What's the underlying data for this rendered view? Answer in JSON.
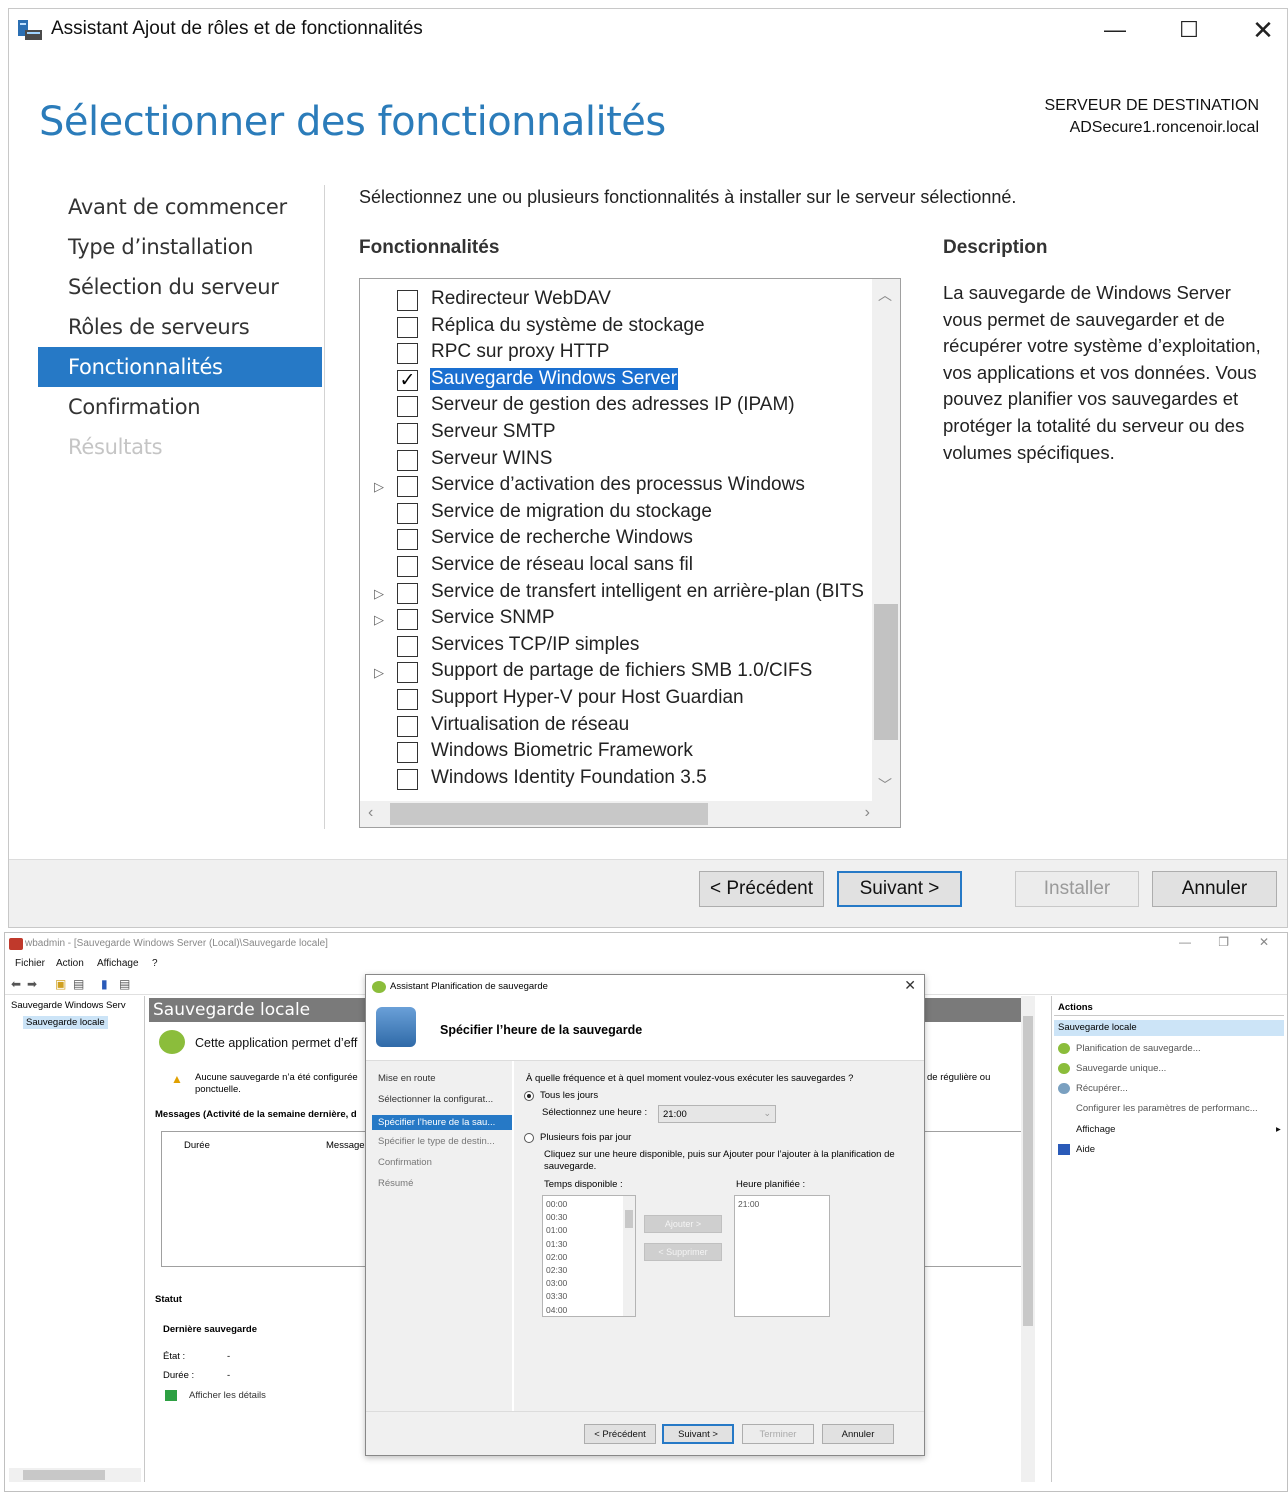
{
  "wizard": {
    "window_title": "Assistant Ajout de rôles et de fonctionnalités",
    "window_controls": {
      "minimize": "—",
      "maximize": "☐",
      "close": "✕"
    },
    "page_title": "Sélectionner des fonctionnalités",
    "destination_label": "SERVEUR DE DESTINATION",
    "destination_server": "ADSecure1.roncenoir.local",
    "nav": [
      {
        "label": "Avant de commencer",
        "state": "normal"
      },
      {
        "label": "Type d’installation",
        "state": "normal"
      },
      {
        "label": "Sélection du serveur",
        "state": "normal"
      },
      {
        "label": "Rôles de serveurs",
        "state": "normal"
      },
      {
        "label": "Fonctionnalités",
        "state": "active"
      },
      {
        "label": "Confirmation",
        "state": "normal"
      },
      {
        "label": "Résultats",
        "state": "disabled"
      }
    ],
    "intro": "Sélectionnez une ou plusieurs fonctionnalités à installer sur le serveur sélectionné.",
    "features_heading": "Fonctionnalités",
    "description_heading": "Description",
    "description_text": "La sauvegarde de Windows Server vous permet de sauvegarder et de récupérer votre système d’exploitation, vos applications et vos données. Vous pouvez planifier vos sauvegardes et protéger la totalité du serveur ou des volumes spécifiques.",
    "features": [
      {
        "label": "Redirecteur WebDAV",
        "checked": false,
        "expandable": false,
        "selected": false
      },
      {
        "label": "Réplica du système de stockage",
        "checked": false,
        "expandable": false,
        "selected": false
      },
      {
        "label": "RPC sur proxy HTTP",
        "checked": false,
        "expandable": false,
        "selected": false
      },
      {
        "label": "Sauvegarde Windows Server",
        "checked": true,
        "expandable": false,
        "selected": true
      },
      {
        "label": "Serveur de gestion des adresses IP (IPAM)",
        "checked": false,
        "expandable": false,
        "selected": false
      },
      {
        "label": "Serveur SMTP",
        "checked": false,
        "expandable": false,
        "selected": false
      },
      {
        "label": "Serveur WINS",
        "checked": false,
        "expandable": false,
        "selected": false
      },
      {
        "label": "Service d’activation des processus Windows",
        "checked": false,
        "expandable": true,
        "selected": false
      },
      {
        "label": "Service de migration du stockage",
        "checked": false,
        "expandable": false,
        "selected": false
      },
      {
        "label": "Service de recherche Windows",
        "checked": false,
        "expandable": false,
        "selected": false
      },
      {
        "label": "Service de réseau local sans fil",
        "checked": false,
        "expandable": false,
        "selected": false
      },
      {
        "label": "Service de transfert intelligent en arrière-plan (BITS",
        "checked": false,
        "expandable": true,
        "selected": false
      },
      {
        "label": "Service SNMP",
        "checked": false,
        "expandable": true,
        "selected": false
      },
      {
        "label": "Services TCP/IP simples",
        "checked": false,
        "expandable": false,
        "selected": false
      },
      {
        "label": "Support de partage de fichiers SMB 1.0/CIFS",
        "checked": false,
        "expandable": true,
        "selected": false
      },
      {
        "label": "Support Hyper-V pour Host Guardian",
        "checked": false,
        "expandable": false,
        "selected": false
      },
      {
        "label": "Virtualisation de réseau",
        "checked": false,
        "expandable": false,
        "selected": false
      },
      {
        "label": "Windows Biometric Framework",
        "checked": false,
        "expandable": false,
        "selected": false
      },
      {
        "label": "Windows Identity Foundation 3.5",
        "checked": false,
        "expandable": false,
        "selected": false
      }
    ],
    "buttons": {
      "previous": "< Précédent",
      "next": "Suivant >",
      "install": "Installer",
      "cancel": "Annuler"
    },
    "accent_color": "#2679c6"
  },
  "wbadmin": {
    "title": "wbadmin - [Sauvegarde Windows Server (Local)\\Sauvegarde locale]",
    "menu": [
      "Fichier",
      "Action",
      "Affichage",
      "?"
    ],
    "tree": {
      "root": "Sauvegarde Windows Serv",
      "child": "Sauvegarde locale"
    },
    "center": {
      "header": "Sauvegarde locale",
      "app_desc": "Cette application permet d’eff",
      "warning": "Aucune sauvegarde n’a été configurée ponctuelle.",
      "right_fragment": "de régulière ou",
      "messages_heading": "Messages (Activité de la semaine dernière, d",
      "col_duration": "Durée",
      "col_message": "Message",
      "status_heading": "Statut",
      "last_backup": "Dernière sauvegarde",
      "state_label": "État :",
      "state_value": "-",
      "duration_label": "Durée :",
      "duration_value": "-",
      "details_link": "Afficher les détails"
    },
    "actions": {
      "heading": "Actions",
      "section": "Sauvegarde locale",
      "items": [
        "Planification de sauvegarde...",
        "Sauvegarde unique...",
        "Récupérer...",
        "Configurer les paramètres de performanc...",
        "Affichage",
        "Aide"
      ]
    }
  },
  "schedule_wizard": {
    "title": "Assistant Planification de sauvegarde",
    "header": "Spécifier l’heure de la sauvegarde",
    "steps": [
      {
        "label": "Mise en route",
        "state": "normal"
      },
      {
        "label": "Sélectionner la configurat...",
        "state": "normal"
      },
      {
        "label": "Spécifier l’heure de la sau...",
        "state": "active"
      },
      {
        "label": "Spécifier le type de destin...",
        "state": "dim"
      },
      {
        "label": "Confirmation",
        "state": "dim"
      },
      {
        "label": "Résumé",
        "state": "dim"
      }
    ],
    "question": "À quelle fréquence et à quel moment voulez-vous exécuter les sauvegardes ?",
    "option_daily": "Tous les jours",
    "select_time_label": "Sélectionnez une heure :",
    "selected_time": "21:00",
    "option_multiple": "Plusieurs fois par jour",
    "hint": "Cliquez sur une heure disponible, puis sur Ajouter pour l’ajouter à la planification de sauvegarde.",
    "available_label": "Temps disponible :",
    "scheduled_label": "Heure planifiée :",
    "available_times": [
      "00:00",
      "00:30",
      "01:00",
      "01:30",
      "02:00",
      "02:30",
      "03:00",
      "03:30",
      "04:00"
    ],
    "scheduled_times": [
      "21:00"
    ],
    "add_button": "Ajouter >",
    "remove_button": "< Supprimer",
    "buttons": {
      "previous": "< Précédent",
      "next": "Suivant >",
      "finish": "Terminer",
      "cancel": "Annuler"
    }
  }
}
